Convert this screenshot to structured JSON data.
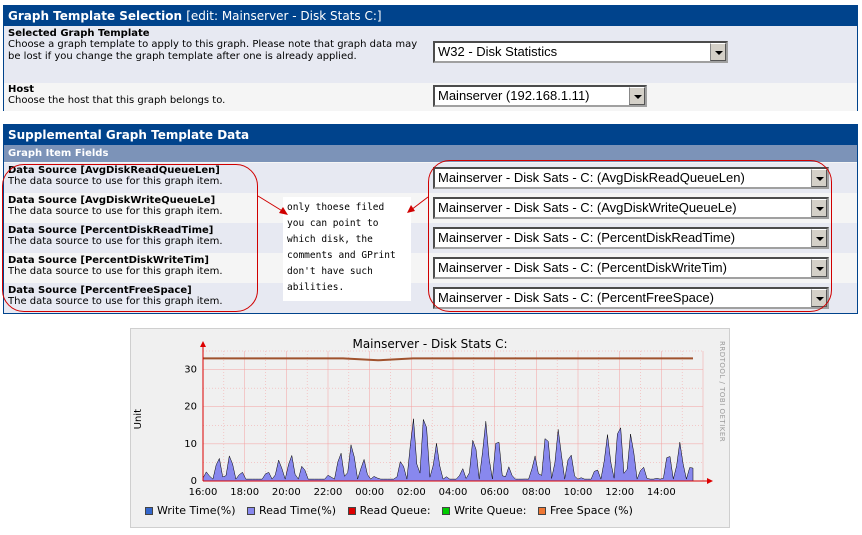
{
  "template_panel": {
    "title": "Graph Template Selection",
    "edit_suffix": "[edit: Mainserver - Disk Stats C:]",
    "template_field": {
      "label": "Selected Graph Template",
      "description": "Choose a graph template to apply to this graph. Please note that graph data may be lost if you change the graph template after one is already applied.",
      "value": "W32 - Disk Statistics"
    },
    "host_field": {
      "label": "Host",
      "description": "Choose the host that this graph belongs to.",
      "value": "Mainserver (192.168.1.11)"
    }
  },
  "supplemental_panel": {
    "title": "Supplemental Graph Template Data",
    "subheader": "Graph Item Fields",
    "data_sources": [
      {
        "label": "Data Source [AvgDiskReadQueueLen]",
        "description": "The data source to use for this graph item.",
        "value": "Mainserver - Disk Sats - C: (AvgDiskReadQueueLen)"
      },
      {
        "label": "Data Source [AvgDiskWriteQueueLe]",
        "description": "The data source to use for this graph item.",
        "value": "Mainserver - Disk Sats - C: (AvgDiskWriteQueueLe)"
      },
      {
        "label": "Data Source [PercentDiskReadTime]",
        "description": "The data source to use for this graph item.",
        "value": "Mainserver - Disk Sats - C: (PercentDiskReadTime)"
      },
      {
        "label": "Data Source [PercentDiskWriteTim]",
        "description": "The data source to use for this graph item.",
        "value": "Mainserver - Disk Sats - C: (PercentDiskWriteTim)"
      },
      {
        "label": "Data Source [PercentFreeSpace]",
        "description": "The data source to use for this graph item.",
        "value": "Mainserver - Disk Sats - C: (PercentFreeSpace)"
      }
    ]
  },
  "annotation": {
    "lines": [
      "only thoese filed",
      "you can point to",
      "which disk, the",
      "comments and GPrint",
      "don't have such",
      "abilities."
    ],
    "color": "#d00000"
  },
  "graph": {
    "title": "Mainserver - Disk Stats C:",
    "side_label": "RRDTOOL / TOBI OETIKER",
    "y_unit": "Unit",
    "y_ticks": [
      "0",
      "10",
      "20",
      "30"
    ],
    "x_ticks": [
      "16:00",
      "18:00",
      "20:00",
      "22:00",
      "00:00",
      "02:00",
      "04:00",
      "06:00",
      "08:00",
      "10:00",
      "12:00",
      "14:00"
    ],
    "legend": [
      {
        "label": "Write Time(%)",
        "color": "#3366CC"
      },
      {
        "label": "Read Time(%)",
        "color": "#8888EE"
      },
      {
        "label": "Read Queue:",
        "color": "#DD0000"
      },
      {
        "label": "Write Queue:",
        "color": "#00CC00"
      },
      {
        "label": "Free Space (%)",
        "color": "#EE7733"
      }
    ],
    "colors": {
      "area": "#8888EE",
      "free_space_line": "#A0522D",
      "grid": "#F4A0A0",
      "axis": "#DD0000"
    }
  },
  "chart_data": {
    "type": "area",
    "title": "Mainserver - Disk Stats C:",
    "xlabel": "",
    "ylabel": "Unit",
    "ylim": [
      0,
      35
    ],
    "grid": true,
    "legend_placement": "bottom",
    "x": [
      "16:00",
      "18:00",
      "20:00",
      "22:00",
      "00:00",
      "02:00",
      "04:00",
      "06:00",
      "08:00",
      "10:00",
      "12:00",
      "14:00"
    ],
    "series": [
      {
        "name": "Read Time(%)",
        "type": "area",
        "values": [
          3,
          11,
          6,
          9,
          12,
          5,
          19,
          22,
          16,
          18,
          14,
          20,
          16,
          24,
          4
        ]
      },
      {
        "name": "Free Space (%)",
        "type": "line",
        "values": [
          33,
          33,
          33,
          33,
          33,
          32.5,
          33,
          33,
          33,
          33,
          33,
          33,
          33,
          33,
          33
        ]
      }
    ]
  }
}
